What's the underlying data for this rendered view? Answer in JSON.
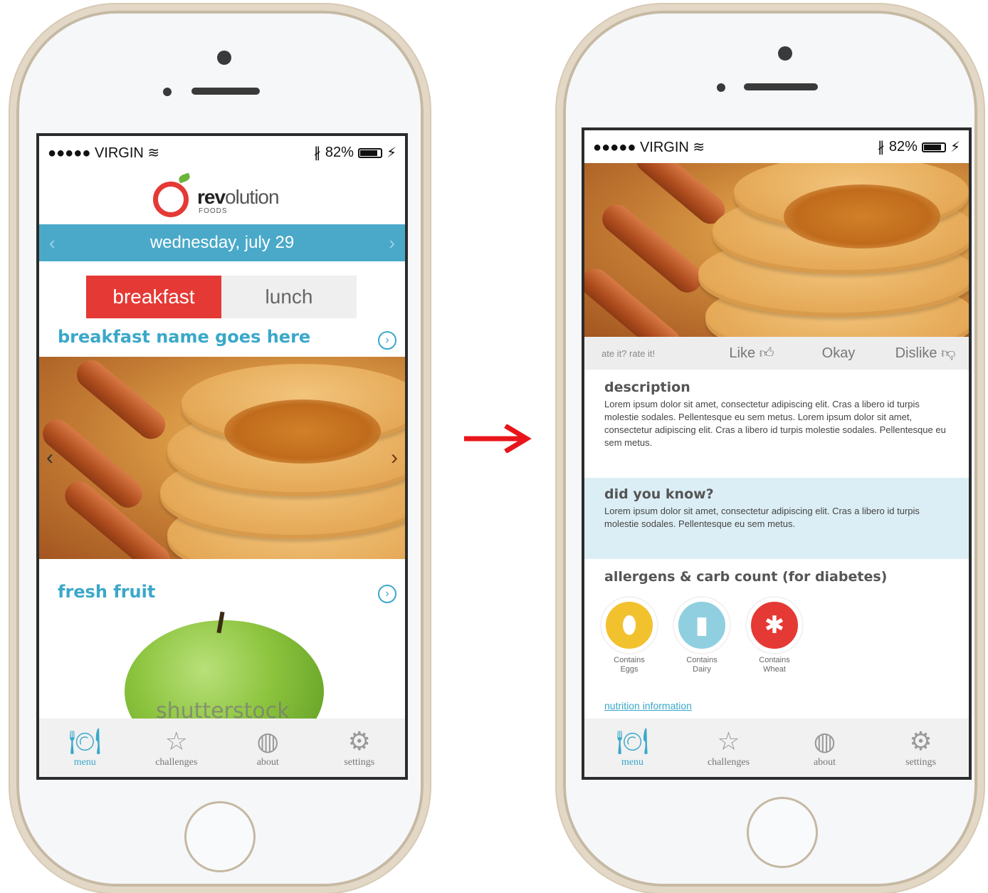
{
  "status_bar": {
    "carrier": "●●●●● VIRGIN",
    "battery_pct": "82%"
  },
  "app": {
    "logo_text_bold": "rev",
    "logo_text_rest": "olution",
    "logo_sub": "FOODS",
    "date": "wednesday, july 29",
    "meal_tabs": [
      "breakfast",
      "lunch"
    ],
    "active_meal": "breakfast",
    "items": [
      {
        "name": "breakfast name goes here"
      },
      {
        "name": "fresh fruit",
        "watermark": "shutterstock"
      }
    ]
  },
  "detail": {
    "rating": {
      "hint": "ate it? rate it!",
      "options": [
        "Like",
        "Okay",
        "Dislike"
      ]
    },
    "description": {
      "title": "description",
      "body": "Lorem ipsum dolor sit amet, consectetur adipiscing elit. Cras a libero id turpis molestie sodales. Pellentesque eu sem metus. Lorem ipsum dolor sit amet, consectetur adipiscing elit. Cras a libero id turpis molestie sodales. Pellentesque eu sem metus."
    },
    "did_you_know": {
      "title": "did you know?",
      "body": "Lorem ipsum dolor sit amet, consectetur adipiscing elit. Cras a libero id turpis molestie sodales. Pellentesque eu sem metus."
    },
    "allergens_title": "allergens & carb count (for diabetes)",
    "allergens": [
      {
        "label_1": "Contains",
        "label_2": "Eggs",
        "color": "#f2c12e"
      },
      {
        "label_1": "Contains",
        "label_2": "Dairy",
        "color": "#8fcfe0"
      },
      {
        "label_1": "Contains",
        "label_2": "Wheat",
        "color": "#e53935"
      }
    ],
    "nutrition_link": "nutrition information"
  },
  "tabbar": [
    {
      "label": "menu",
      "icon": "utensils-icon",
      "active": true
    },
    {
      "label": "challenges",
      "icon": "star-icon",
      "active": false
    },
    {
      "label": "about",
      "icon": "globe-icon",
      "active": false
    },
    {
      "label": "settings",
      "icon": "gear-icon",
      "active": false
    }
  ],
  "colors": {
    "accent": "#4aa9c9",
    "brand_red": "#e53935",
    "arrow": "#e8151b"
  }
}
